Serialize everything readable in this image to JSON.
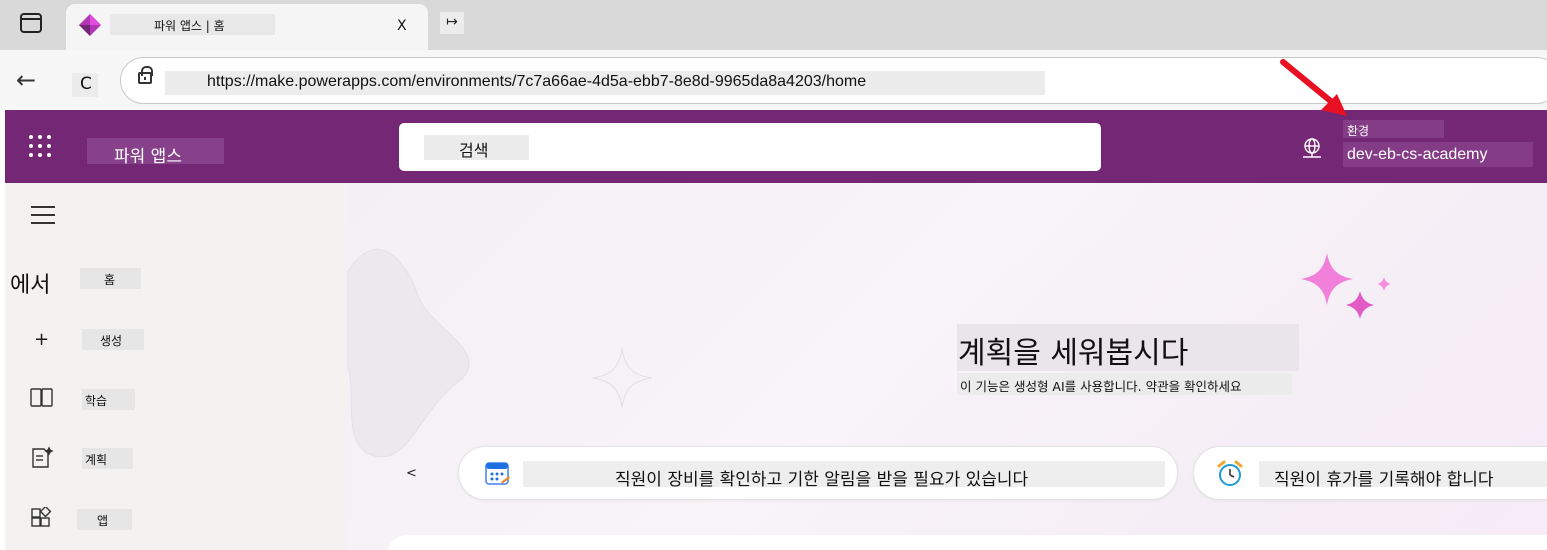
{
  "browser": {
    "tab": {
      "title": "파워 앱스 | 홈",
      "close_label": "X",
      "new_tab_label": "↦"
    },
    "refresh_label": "C",
    "url": "https://make.powerapps.com/environments/7c7a66ae-4d5a-ebb7-8e8d-9965da8a4203/home"
  },
  "header": {
    "app_name": "파워 앱스",
    "search_placeholder": "검색",
    "environment_label": "환경",
    "environment_name": "dev-eb-cs-academy",
    "brand_color": "#742774"
  },
  "sidebar": {
    "prefix": "에서",
    "items": [
      {
        "label": "홈",
        "icon": "none"
      },
      {
        "label": "생성",
        "icon": "plus-icon"
      },
      {
        "label": "학습",
        "icon": "book-icon"
      },
      {
        "label": "계획",
        "icon": "plan-icon"
      },
      {
        "label": "앱",
        "icon": "apps-icon"
      }
    ]
  },
  "main": {
    "heading": "계획을 세워봅시다",
    "subheading": "이 기능은 생성형 AI를 사용합니다. 약관을 확인하세요",
    "prev_label": "<",
    "suggestions": [
      {
        "text": "직원이 장비를 확인하고 기한 알림을 받을 필요가 있습니다",
        "icon": "calendar-icon"
      },
      {
        "text": "직원이 휴가를 기록해야 합니다",
        "icon": "alarm-clock-icon"
      }
    ]
  },
  "annotation": {
    "arrow_color": "#e81123"
  }
}
